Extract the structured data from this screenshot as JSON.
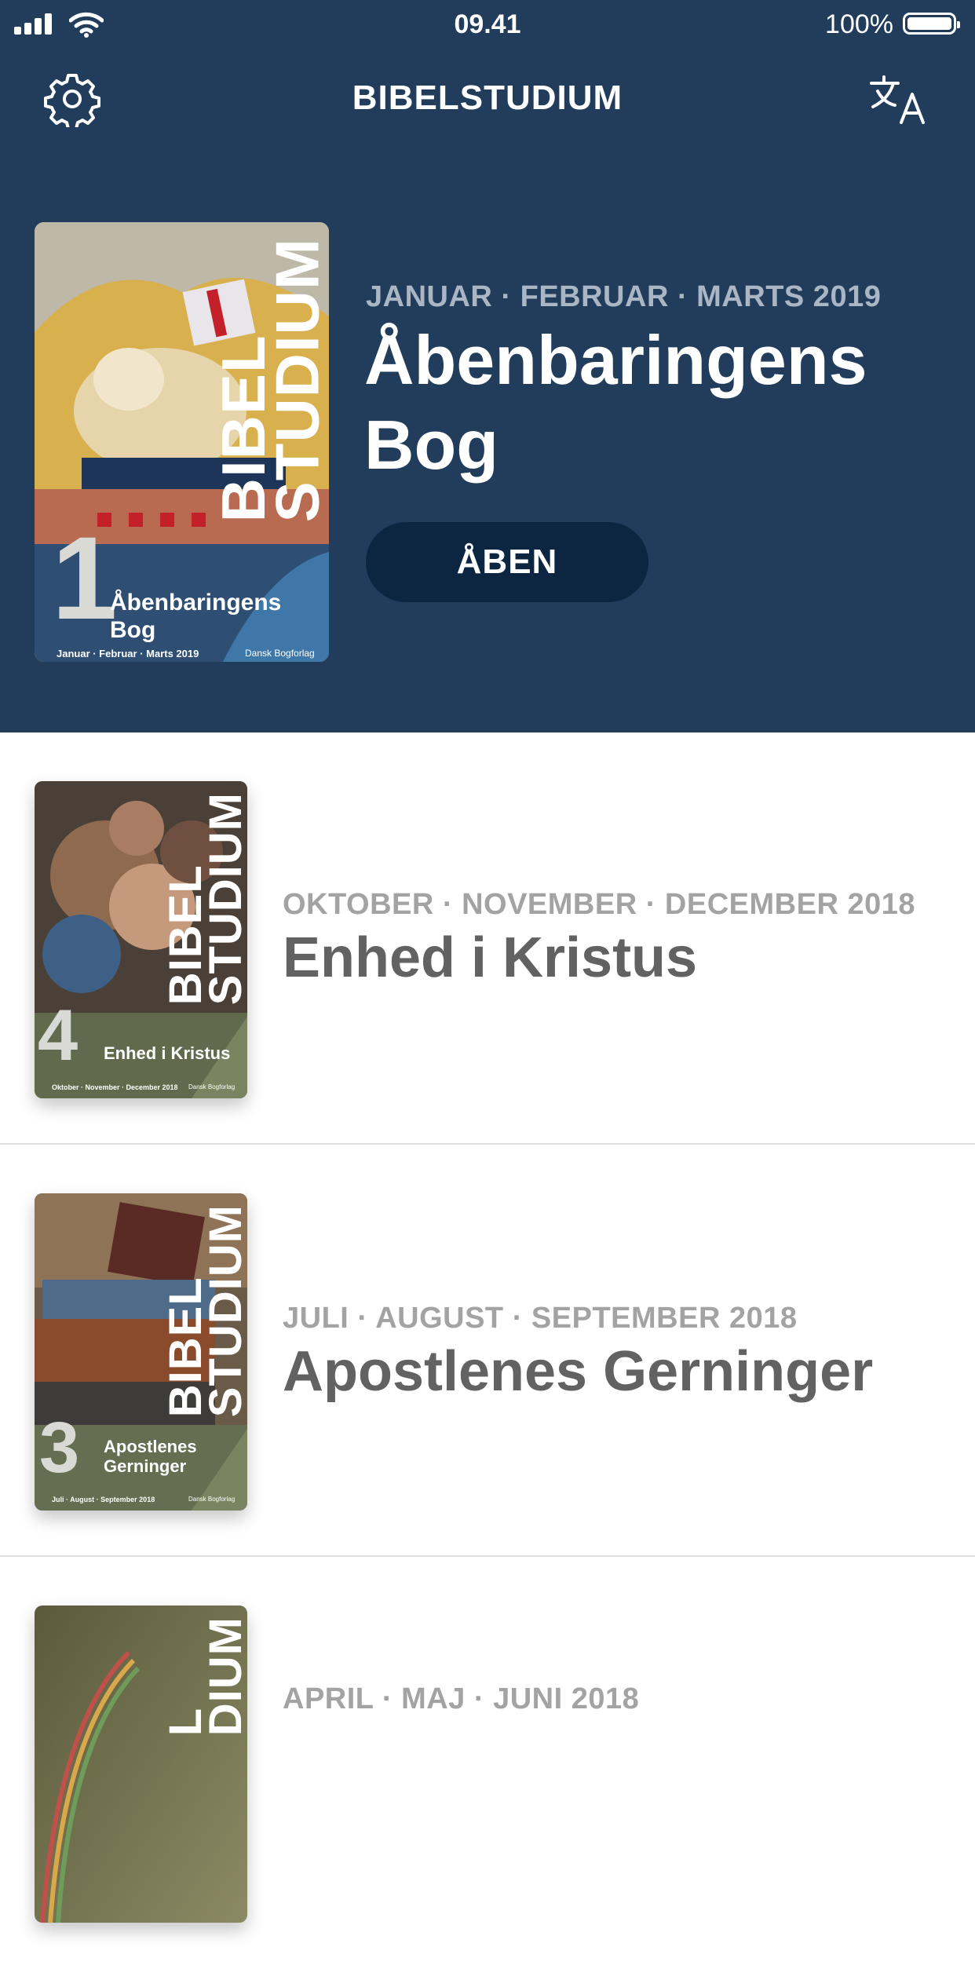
{
  "status_bar": {
    "time": "09.41",
    "battery": "100%"
  },
  "nav": {
    "title": "BIBELSTUDIUM",
    "settings_icon": "gear-icon",
    "language_icon": "translate-icon"
  },
  "featured": {
    "period": "JANUAR · FEBRUAR · MARTS 2019",
    "title_line1": "Åbenbaringens",
    "title_line2": "Bog",
    "button_label": "ÅBEN",
    "cover": {
      "brand_line1": "BIBEL",
      "brand_line2": "STUDIUM",
      "number": "1",
      "title": "Åbenbaringens Bog",
      "footer": "Januar · Februar · Marts 2019",
      "publisher": "Dansk Bogforlag"
    }
  },
  "quarterlies": [
    {
      "period": "OKTOBER · NOVEMBER · DECEMBER 2018",
      "title": "Enhed i Kristus",
      "cover": {
        "brand_line1": "BIBEL",
        "brand_line2": "STUDIUM",
        "number": "4",
        "title": "Enhed i Kristus",
        "footer": "Oktober · November · December 2018",
        "publisher": "Dansk Bogforlag"
      }
    },
    {
      "period": "JULI · AUGUST · SEPTEMBER 2018",
      "title": "Apostlenes Gerninger",
      "cover": {
        "brand_line1": "BIBEL",
        "brand_line2": "STUDIUM",
        "number": "3",
        "title_line1": "Apostlenes",
        "title_line2": "Gerninger",
        "footer": "Juli · August · September 2018",
        "publisher": "Dansk Bogforlag"
      }
    },
    {
      "period": "APRIL · MAJ · JUNI 2018",
      "cover": {
        "brand_line1": "L",
        "brand_line2": "DIUM"
      }
    }
  ],
  "colors": {
    "header_bg": "#223d5c",
    "button_bg": "#0c2540",
    "period_text": "#a3a3a3",
    "title_text": "#626262"
  }
}
